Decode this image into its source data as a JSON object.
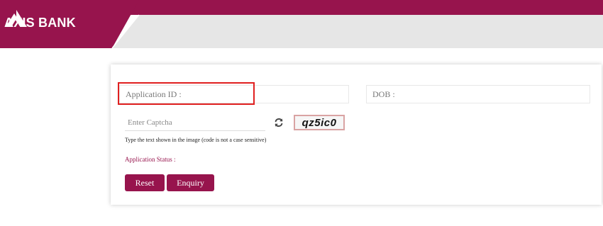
{
  "header": {
    "brand_name": "AXIS BANK",
    "logo": "axis-bank-logo",
    "brand_color": "#97144d",
    "banner_color": "#e6e6e6"
  },
  "form": {
    "application_id_placeholder": "Application ID :",
    "application_id_value": "",
    "dob_placeholder": "DOB :",
    "dob_value": "",
    "captcha_placeholder": "Enter Captcha",
    "captcha_value": "",
    "captcha_text": "qz5ic0",
    "captcha_hint": "Type the text shown in the image (code is not a case sensitive)",
    "refresh_icon": "refresh-icon",
    "status_label": "Application Status :",
    "highlight_color": "#e02020"
  },
  "buttons": {
    "reset_label": "Reset",
    "enquiry_label": "Enquiry"
  }
}
